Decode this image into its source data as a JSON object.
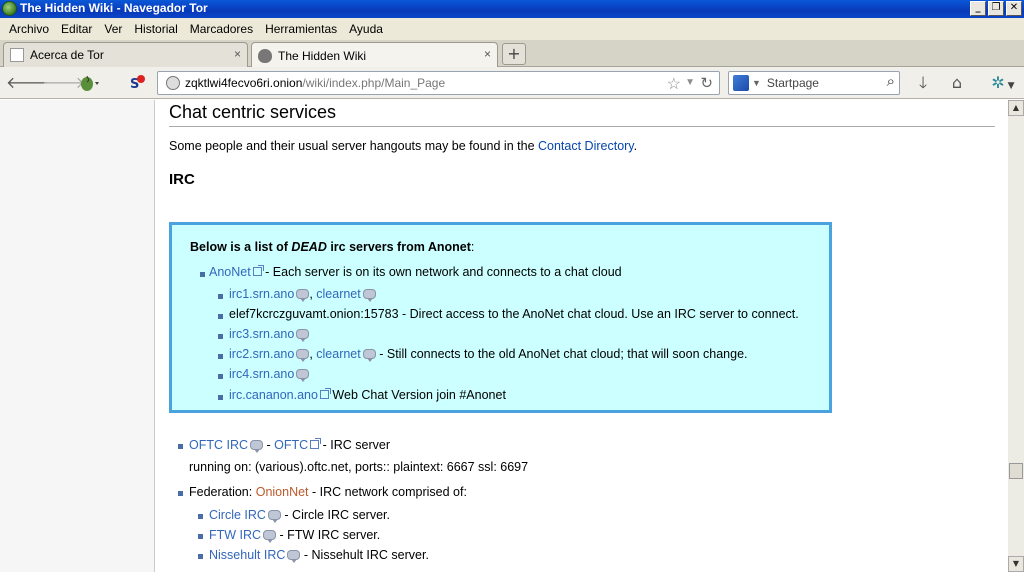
{
  "window": {
    "title": "The Hidden Wiki - Navegador Tor"
  },
  "menu": [
    "Archivo",
    "Editar",
    "Ver",
    "Historial",
    "Marcadores",
    "Herramientas",
    "Ayuda"
  ],
  "tabs": [
    {
      "label": "Acerca de Tor",
      "close": "×"
    },
    {
      "label": "The Hidden Wiki",
      "close": "×"
    }
  ],
  "new_tab": "+",
  "urlbar": {
    "domain": "zqktlwi4fecvo6ri.onion",
    "path": "/wiki/index.php/Main_Page"
  },
  "searchbar": {
    "placeholder": "Startpage"
  },
  "page": {
    "section_title": "Chat centric services",
    "intro_text": "Some people and their usual server hangouts may be found in the ",
    "intro_link": "Contact Directory",
    "intro_end": ".",
    "irc_heading": "IRC",
    "box": {
      "head_1": "Below is a list of ",
      "head_dead": "DEAD",
      "head_2": " irc servers from Anonet",
      "head_colon": ":",
      "anonet_link": "AnoNet",
      "anonet_desc": " - Each server is on its own network and connects to a chat cloud",
      "items": [
        {
          "link": "irc1.srn.ano",
          "sep": ", ",
          "link2": "clearnet",
          "desc": ""
        },
        {
          "text": "elef7kcrczguvamt.onion:15783 - Direct access to the AnoNet chat cloud. Use an IRC server to connect."
        },
        {
          "link": "irc3.srn.ano"
        },
        {
          "link": "irc2.srn.ano",
          "sep": ", ",
          "link2": "clearnet",
          "desc": " - Still connects to the old AnoNet chat cloud; that will soon change."
        },
        {
          "link": "irc4.srn.ano"
        },
        {
          "link": "irc.cananon.ano",
          "desc": " Web Chat Version join #Anonet"
        }
      ]
    },
    "oftc": {
      "link1": "OFTC IRC",
      "sep": " - ",
      "link2": "OFTC",
      "desc": " - IRC server",
      "line2": "running on: (various).oftc.net, ports:: plaintext: 6667 ssl: 6697"
    },
    "federation": {
      "prefix": "Federation: ",
      "link": "OnionNet",
      "desc": " - IRC network comprised of:"
    },
    "fed_items": [
      {
        "link": "Circle IRC",
        "desc": " - Circle IRC server."
      },
      {
        "link": "FTW IRC",
        "desc": " - FTW IRC server."
      },
      {
        "link": "Nissehult IRC",
        "desc": " - Nissehult IRC server."
      }
    ]
  },
  "colors": {
    "titlebar": "#0839b9",
    "box_bg": "#ccffff",
    "box_border": "#4aa3df",
    "link": "#0645ad",
    "onionnet_link": "#ba5a2b"
  }
}
